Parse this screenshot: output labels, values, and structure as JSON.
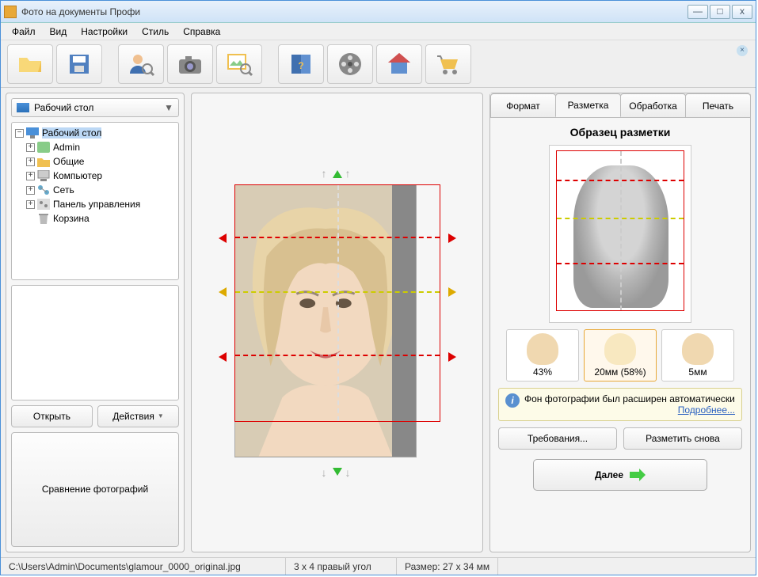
{
  "window": {
    "title": "Фото на документы Профи"
  },
  "menu": {
    "file": "Файл",
    "view": "Вид",
    "settings": "Настройки",
    "style": "Стиль",
    "help": "Справка"
  },
  "left": {
    "combo": "Рабочий стол",
    "tree": {
      "root": "Рабочий стол",
      "admin": "Admin",
      "common": "Общие",
      "computer": "Компьютер",
      "network": "Сеть",
      "control_panel": "Панель управления",
      "trash": "Корзина"
    },
    "open": "Открыть",
    "actions": "Действия",
    "compare": "Сравнение фотографий"
  },
  "tabs": {
    "format": "Формат",
    "markup": "Разметка",
    "processing": "Обработка",
    "print": "Печать"
  },
  "markup": {
    "sample_title": "Образец разметки",
    "m1": "43%",
    "m2": "20мм (58%)",
    "m3": "5мм",
    "info_text": "Фон фотографии был расширен автоматически",
    "info_link": "Подробнее...",
    "requirements": "Требования...",
    "remark": "Разметить снова",
    "next": "Далее"
  },
  "status": {
    "path": "C:\\Users\\Admin\\Documents\\glamour_0000_original.jpg",
    "format": "3 x 4 правый угол",
    "size": "Размер: 27 x 34 мм"
  }
}
